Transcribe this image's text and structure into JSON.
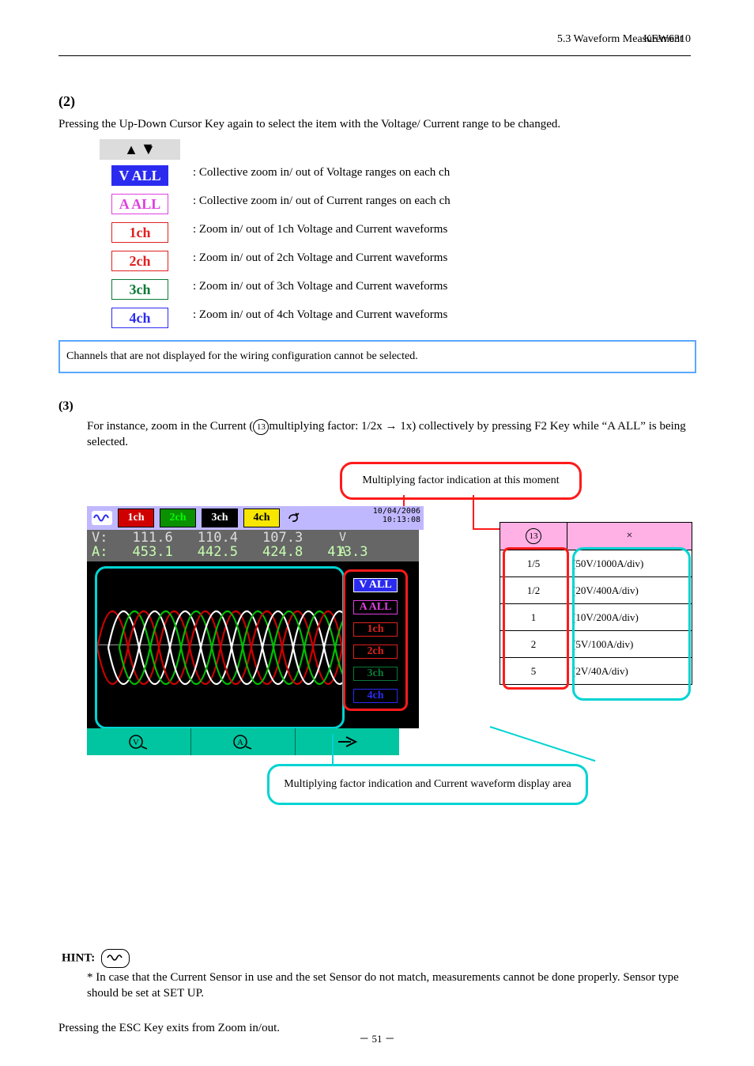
{
  "header": {
    "page_id": "KEW6310",
    "chapter": "5.3 Waveform Measurement"
  },
  "section2": {
    "title": "(2)",
    "text": "Pressing the Up-Down Cursor Key again to select the item with the Voltage/ Current range to be changed.",
    "rangelist": [
      {
        "style": "b-vall",
        "label": "V ALL",
        "desc": ": Collective zoom in/ out of Voltage ranges on each ch"
      },
      {
        "style": "b-aall",
        "label": "A ALL",
        "desc": ": Collective zoom in/ out of Current ranges on each ch"
      },
      {
        "style": "b-1ch",
        "label": "1ch",
        "desc": ": Zoom in/ out of 1ch Voltage and Current waveforms"
      },
      {
        "style": "b-2ch",
        "label": "2ch",
        "desc": ": Zoom in/ out of 2ch Voltage and Current waveforms"
      },
      {
        "style": "b-3ch",
        "label": "3ch",
        "desc": ": Zoom in/ out of 3ch Voltage and Current waveforms"
      },
      {
        "style": "b-4ch",
        "label": "4ch",
        "desc": ": Zoom in/ out of 4ch Voltage and Current waveforms"
      }
    ],
    "note": "Channels that are not displayed for the wiring configuration cannot be selected."
  },
  "section3": {
    "title": "(3)",
    "body_a": "For instance, zoom in the Current (",
    "body_b": "multiplying factor: 1/2x → 1x) collectively by pressing F2 Key while “A ALL” is being selected.",
    "screenshot": {
      "datetime_top": "10/04/2006",
      "datetime_bot": "10:13:08",
      "ch": [
        "1ch",
        "2ch",
        "3ch",
        "4ch"
      ],
      "V_label": "V:",
      "A_label": "A:",
      "V": [
        "111.6",
        "110.4",
        "107.3",
        ""
      ],
      "A": [
        "453.1",
        "442.5",
        "424.8",
        "413.3"
      ],
      "unitV": "V",
      "unitA": "A",
      "side": [
        {
          "style": "b-vall",
          "label": "V ALL"
        },
        {
          "style": "b-aall",
          "label": "A ALL"
        },
        {
          "style": "b-1ch",
          "label": "1ch"
        },
        {
          "style": "b-2ch",
          "label": "2ch"
        },
        {
          "style": "b-3ch",
          "label": "3ch"
        },
        {
          "style": "b-4ch",
          "label": "4ch"
        }
      ]
    },
    "callout_red": "Multiplying factor indication at this moment",
    "callout_cyan": "Multiplying factor indication and Current waveform display area",
    "table": {
      "hcol2": "×",
      "rows": [
        {
          "c1": "1/5",
          "c2": "(50V/1000A/div)"
        },
        {
          "c1": "1/2",
          "c2": "(20V/400A/div)"
        },
        {
          "c1": "1",
          "c2": "(10V/200A/div)"
        },
        {
          "c1": "2",
          "c2": "(5V/100A/div)"
        },
        {
          "c1": "5",
          "c2": "(2V/40A/div)"
        }
      ]
    }
  },
  "hint": {
    "label": "HINT:",
    "body": "* In case that the Current Sensor in use and the set Sensor do not match, measurements cannot be done properly. Sensor type should be set at SET UP."
  },
  "exit": "Pressing the ESC Key exits from Zoom in/out."
}
